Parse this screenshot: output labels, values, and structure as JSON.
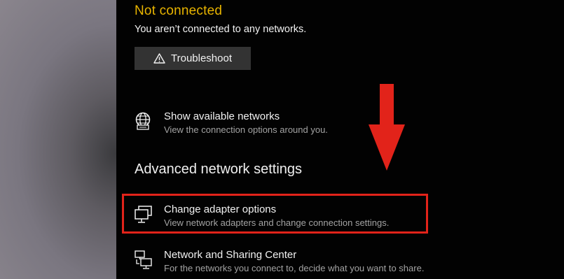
{
  "network": {
    "status_title": "Not connected",
    "status_desc": "You aren’t connected to any networks.",
    "troubleshoot_label": "Troubleshoot"
  },
  "options": [
    {
      "title": "Show available networks",
      "subtitle": "View the connection options around you.",
      "icon": "globe-network-icon"
    }
  ],
  "advanced": {
    "heading": "Advanced network settings",
    "items": [
      {
        "title": "Change adapter options",
        "subtitle": "View network adapters and change connection settings.",
        "icon": "adapter-monitor-icon",
        "highlighted": true
      },
      {
        "title": "Network and Sharing Center",
        "subtitle": "For the networks you connect to, decide what you want to share.",
        "icon": "sharing-center-icon"
      }
    ]
  },
  "colors": {
    "status": "#e8b400",
    "highlight": "#e2231a",
    "arrow": "#e2231a",
    "background": "#020202",
    "button": "#333333"
  }
}
